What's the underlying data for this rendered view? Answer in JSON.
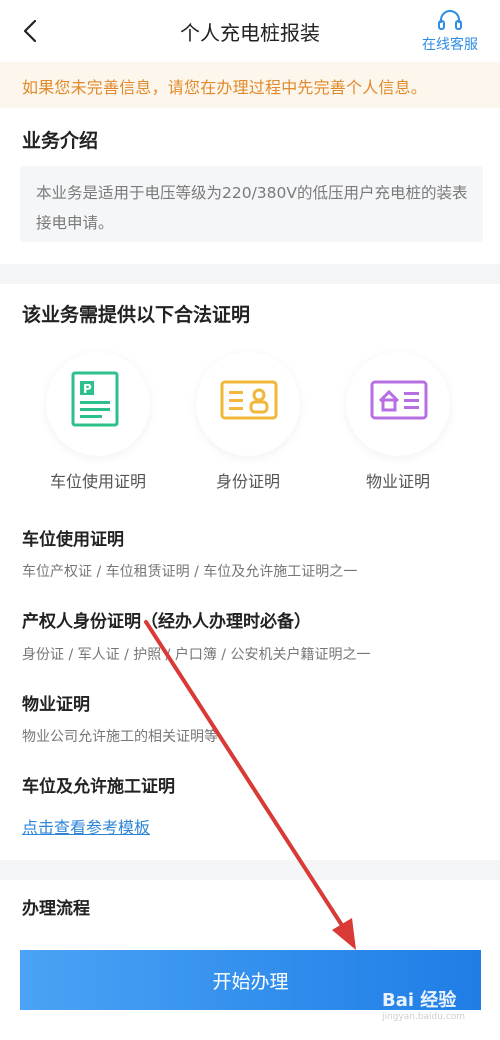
{
  "header": {
    "title": "个人充电桩报装",
    "service_label": "在线客服"
  },
  "notice": {
    "text": "如果您未完善信息，请您在办理过程中先完善个人信息。"
  },
  "intro": {
    "title": "业务介绍",
    "body": "本业务是适用于电压等级为220/380V的低压用户充电桩的装表接电申请。"
  },
  "documents": {
    "title": "该业务需提供以下合法证明",
    "items": [
      {
        "label": "车位使用证明",
        "icon": "parking-document-icon",
        "color": "#2ec08a"
      },
      {
        "label": "身份证明",
        "icon": "id-card-icon",
        "color": "#f2b63a"
      },
      {
        "label": "物业证明",
        "icon": "property-document-icon",
        "color": "#b76ee0"
      }
    ]
  },
  "requirements": [
    {
      "title": "车位使用证明",
      "desc": "车位产权证 / 车位租赁证明 / 车位及允许施工证明之一"
    },
    {
      "title": "产权人身份证明（经办人办理时必备）",
      "desc": "身份证 / 军人证 / 护照 / 户口簿 / 公安机关户籍证明之一"
    },
    {
      "title": "物业证明",
      "desc": "物业公司允许施工的相关证明等"
    },
    {
      "title": "车位及允许施工证明",
      "desc": ""
    }
  ],
  "template_link": "点击查看参考模板",
  "process": {
    "title": "办理流程"
  },
  "start_button": "开始办理",
  "watermark": {
    "brand": "Bai 经验",
    "url": "jingyan.baidu.com"
  },
  "colors": {
    "accent": "#2f8de4",
    "notice_text": "#e08a2c",
    "notice_bg": "#fdf6ec",
    "button_start": "#4aa3f5",
    "button_end": "#1f7de6",
    "annotation_arrow": "#d93a36"
  }
}
